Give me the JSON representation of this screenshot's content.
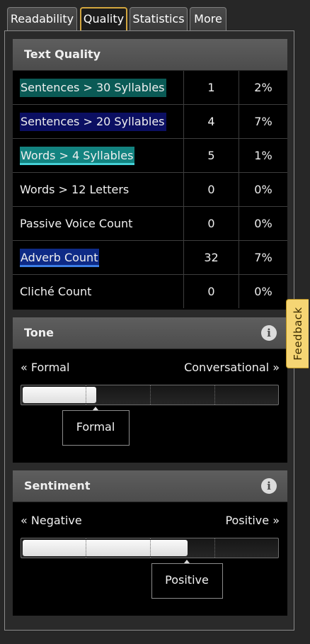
{
  "tabs": [
    {
      "label": "Readability"
    },
    {
      "label": "Quality"
    },
    {
      "label": "Statistics"
    },
    {
      "label": "More"
    }
  ],
  "active_tab": "Quality",
  "text_quality": {
    "title": "Text Quality",
    "rows": [
      {
        "label": "Sentences > 30 Syllables",
        "count": "1",
        "percent": "2%",
        "highlight": "#0a5a55"
      },
      {
        "label": "Sentences > 20 Syllables",
        "count": "4",
        "percent": "7%",
        "highlight": "#0b0f62"
      },
      {
        "label": "Words > 4 Syllables",
        "count": "5",
        "percent": "1%",
        "highlight": "#138380"
      },
      {
        "label": "Words > 12 Letters",
        "count": "0",
        "percent": "0%",
        "highlight": ""
      },
      {
        "label": "Passive Voice Count",
        "count": "0",
        "percent": "0%",
        "highlight": ""
      },
      {
        "label": "Adverb Count",
        "count": "32",
        "percent": "7%",
        "highlight": "#0e2a86"
      },
      {
        "label": "Cliché Count",
        "count": "0",
        "percent": "0%",
        "highlight": ""
      }
    ]
  },
  "tone": {
    "title": "Tone",
    "left_label": "« Formal",
    "right_label": "Conversational »",
    "level": 0.29,
    "result": "Formal"
  },
  "sentiment": {
    "title": "Sentiment",
    "left_label": "« Negative",
    "right_label": "Positive »",
    "level": 0.65,
    "result": "Positive"
  },
  "feedback": {
    "label": "Feedback"
  },
  "icons": {
    "info": "info-icon"
  },
  "colors": {
    "active_tab_border": "#d2a63e",
    "feedback_bg": "#f5d574",
    "section_header": "#555555"
  }
}
